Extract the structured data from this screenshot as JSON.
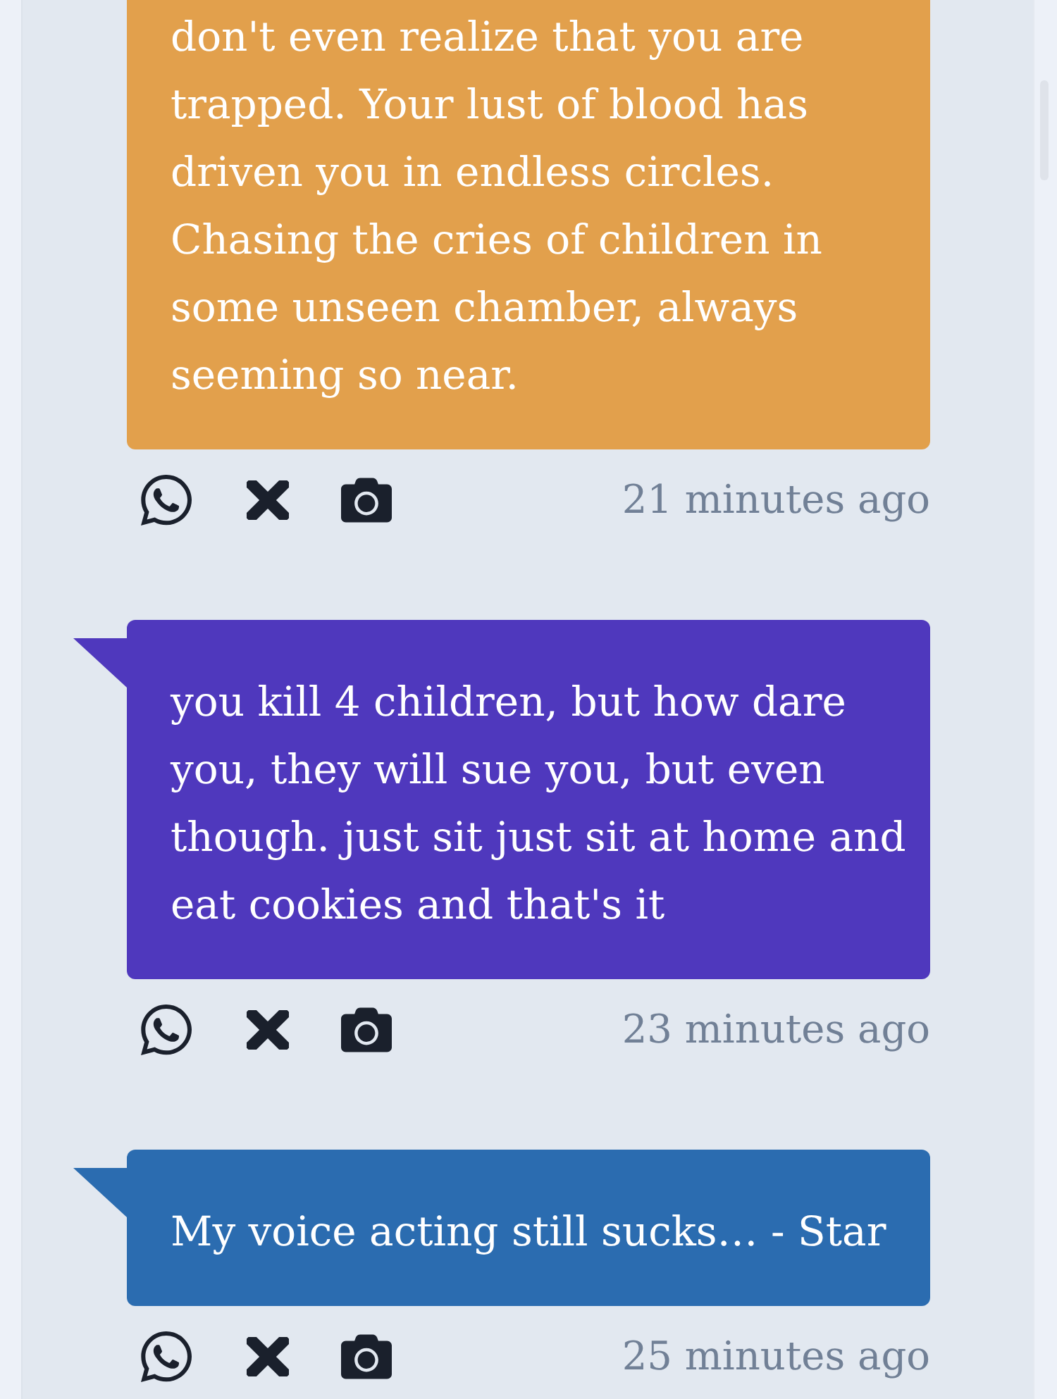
{
  "messages": [
    {
      "text": "don't even realize that you are trapped. Your lust of blood has driven you in endless circles. Chasing the cries of children in some unseen chamber, always seeming so near.",
      "color": "#e2a04c",
      "clipped_top": true,
      "time": "21 minutes ago"
    },
    {
      "text": "you kill 4 children, but how dare you, they will sue you, but even though. just sit just sit at home and eat cookies and that's it",
      "color": "#4f38bd",
      "clipped_top": false,
      "time": "23 minutes ago"
    },
    {
      "text": "My voice acting still sucks… - Star",
      "color": "#2b6cb0",
      "clipped_top": false,
      "time": "25 minutes ago"
    }
  ]
}
